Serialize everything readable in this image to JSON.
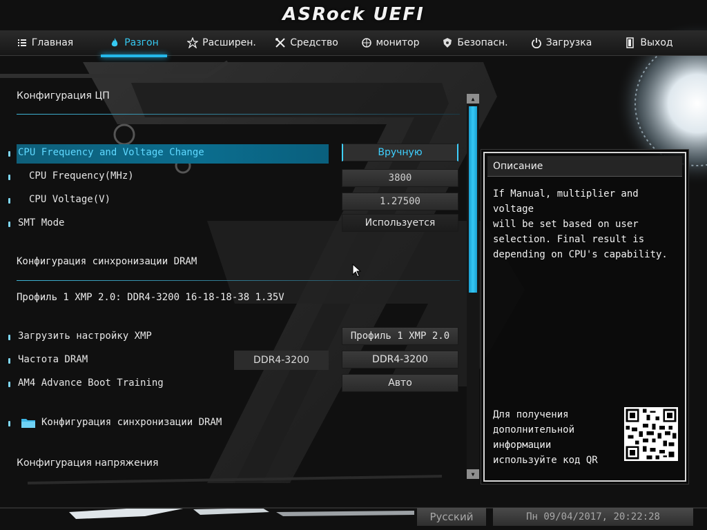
{
  "brand": "ASRock UEFI",
  "nav": [
    {
      "label": "Главная",
      "icon": "list-icon",
      "active": false
    },
    {
      "label": "Разгон",
      "icon": "flame-icon",
      "active": true
    },
    {
      "label": "Расширен.",
      "icon": "star-icon",
      "active": false
    },
    {
      "label": "Средство",
      "icon": "tools-icon",
      "active": false
    },
    {
      "label": "монитор",
      "icon": "monitor-icon",
      "active": false
    },
    {
      "label": "Безопасн.",
      "icon": "shield-icon",
      "active": false
    },
    {
      "label": "Загрузка",
      "icon": "power-icon",
      "active": false
    },
    {
      "label": "Выход",
      "icon": "exit-icon",
      "active": false
    }
  ],
  "main": {
    "cpu_section_title": "Конфигурация ЦП",
    "cpu_rows": [
      {
        "label": "CPU Frequency and Voltage Change",
        "value": "Вручную"
      },
      {
        "label": "CPU Frequency(MHz)",
        "value": "3800"
      },
      {
        "label": "CPU Voltage(V)",
        "value": "1.27500"
      },
      {
        "label": "SMT Mode",
        "value": "Используется"
      }
    ],
    "dram_section_title": "Конфигурация синхронизации DRAM",
    "xmp_profile_line": "Профиль 1 XMP 2.0: DDR4-3200 16-18-18-38 1.35V",
    "dram_rows": [
      {
        "label": "Загрузить настройку XMP",
        "value": "Профиль 1 XMP 2.0"
      },
      {
        "label": "Частота DRAM",
        "readout": "DDR4-3200",
        "value": "DDR4-3200"
      },
      {
        "label": "AM4 Advance Boot Training",
        "value": "Авто"
      }
    ],
    "dram_submenu_label": "Конфигурация синхронизации DRAM",
    "voltage_section_title": "Конфигурация напряжения"
  },
  "description": {
    "title": "Описание",
    "text": "If Manual, multiplier and voltage\nwill be set based on user\nselection. Final result is\ndepending on CPU's capability.",
    "qr_text": "Для получения\nдополнительной\nинформации\nиспользуйте код QR"
  },
  "footer": {
    "language": "Русский",
    "datetime": "Пн 09/04/2017, 20:22:28"
  },
  "colors": {
    "accent": "#24b8ea",
    "highlight_row": "#0b6d8e"
  }
}
